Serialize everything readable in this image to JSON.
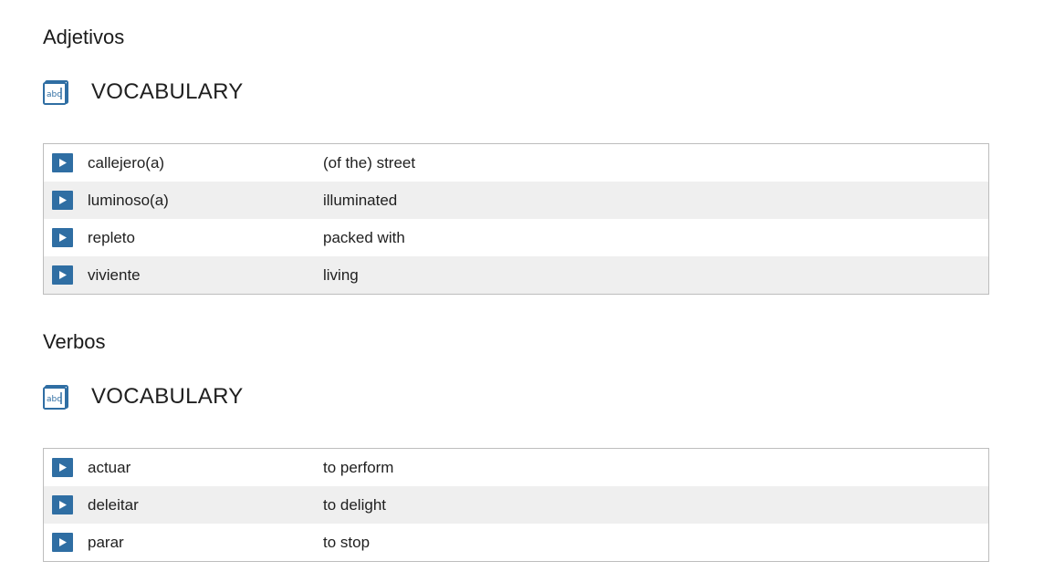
{
  "sections": [
    {
      "title": "Adjetivos",
      "vocab_label": "VOCABULARY",
      "icon": "abc-book-icon",
      "rows": [
        {
          "term": "callejero(a)",
          "meaning": "(of the) street"
        },
        {
          "term": "luminoso(a)",
          "meaning": "illuminated"
        },
        {
          "term": "repleto",
          "meaning": "packed with"
        },
        {
          "term": "viviente",
          "meaning": "living"
        }
      ]
    },
    {
      "title": "Verbos",
      "vocab_label": "VOCABULARY",
      "icon": "abc-book-icon",
      "rows": [
        {
          "term": "actuar",
          "meaning": "to perform"
        },
        {
          "term": "deleitar",
          "meaning": "to delight"
        },
        {
          "term": "parar",
          "meaning": "to stop"
        }
      ]
    }
  ],
  "colors": {
    "play_button": "#2f6ea3",
    "row_alt": "#efefef",
    "border": "#bdbdbd"
  },
  "icons": {
    "play": "play-icon",
    "vocab": "abc-book-icon"
  }
}
